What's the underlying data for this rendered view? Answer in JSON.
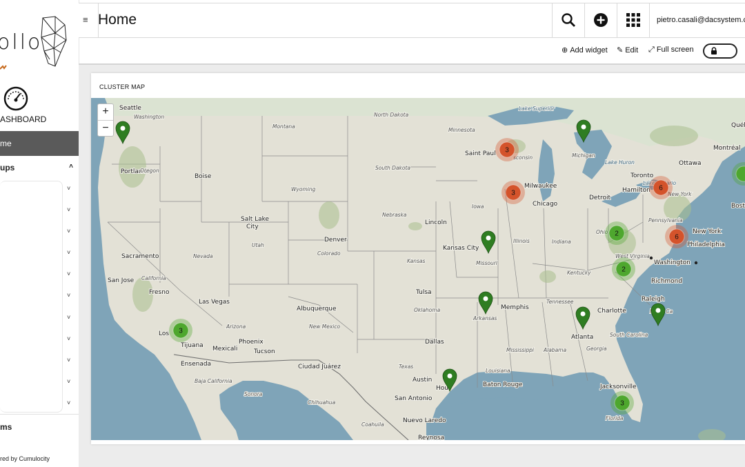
{
  "sidebar": {
    "brand_text": "ollo",
    "dashboard_label": "ASHBOARD",
    "home_item": "me",
    "groups_label": "ups",
    "alarms_label": "ms",
    "powered_by": "red by Cumulocity"
  },
  "header": {
    "title": "Home",
    "user_email": "pietro.casali@dacsystem.c"
  },
  "actions": {
    "add_widget": "Add widget",
    "edit": "Edit",
    "full_screen": "Full screen"
  },
  "widget": {
    "title": "CLUSTER MAP",
    "zoom_in": "+",
    "zoom_out": "−"
  },
  "colors": {
    "cluster_green": "#4ea72e",
    "cluster_red": "#d4532b",
    "pin_green": "#2f7d22",
    "water": "#7fa4b8",
    "land": "#e3e1d6"
  },
  "map": {
    "labels": [
      {
        "id": "seattle",
        "text": "Seattle",
        "kind": "city"
      },
      {
        "id": "washington-st",
        "text": "Washington",
        "kind": "state"
      },
      {
        "id": "portland",
        "text": "Portland",
        "kind": "city"
      },
      {
        "id": "oregon",
        "text": "Oregon",
        "kind": "state"
      },
      {
        "id": "montana",
        "text": "Montana",
        "kind": "state"
      },
      {
        "id": "north-dakota",
        "text": "North Dakota",
        "kind": "state"
      },
      {
        "id": "south-dakota",
        "text": "South Dakota",
        "kind": "state"
      },
      {
        "id": "minnesota",
        "text": "Minnesota",
        "kind": "state"
      },
      {
        "id": "lake-superior",
        "text": "Lake Superior",
        "kind": "water"
      },
      {
        "id": "boise",
        "text": "Boise",
        "kind": "city"
      },
      {
        "id": "wyoming",
        "text": "Wyoming",
        "kind": "state"
      },
      {
        "id": "saint-paul",
        "text": "Saint Paul",
        "kind": "city"
      },
      {
        "id": "wisconsin",
        "text": "sconsin",
        "kind": "state"
      },
      {
        "id": "michigan",
        "text": "Michigan",
        "kind": "state"
      },
      {
        "id": "lake-huron",
        "text": "Lake Huron",
        "kind": "water"
      },
      {
        "id": "ottawa",
        "text": "Ottawa",
        "kind": "city"
      },
      {
        "id": "montreal",
        "text": "Montréal",
        "kind": "city"
      },
      {
        "id": "quebec",
        "text": "Québe",
        "kind": "city"
      },
      {
        "id": "toronto",
        "text": "Toronto",
        "kind": "city"
      },
      {
        "id": "hamilton",
        "text": "Hamilton",
        "kind": "city"
      },
      {
        "id": "new-york-st",
        "text": "New York",
        "kind": "state"
      },
      {
        "id": "lake-ontario",
        "text": "Lake Ontario",
        "kind": "water"
      },
      {
        "id": "milwaukee",
        "text": "Milwaukee",
        "kind": "city"
      },
      {
        "id": "chicago",
        "text": "Chicago",
        "kind": "city"
      },
      {
        "id": "detroit",
        "text": "Detroit",
        "kind": "city"
      },
      {
        "id": "boston",
        "text": "Bost",
        "kind": "city"
      },
      {
        "id": "salt-lake-city",
        "text": "Salt Lake\nCity",
        "kind": "city"
      },
      {
        "id": "nebraska",
        "text": "Nebraska",
        "kind": "state"
      },
      {
        "id": "iowa",
        "text": "Iowa",
        "kind": "state"
      },
      {
        "id": "lincoln",
        "text": "Lincoln",
        "kind": "city"
      },
      {
        "id": "pennsylvania",
        "text": "Pennsylvania",
        "kind": "state"
      },
      {
        "id": "new-york-city",
        "text": "New York",
        "kind": "city"
      },
      {
        "id": "ohio",
        "text": "Ohio",
        "kind": "state"
      },
      {
        "id": "philadelphia",
        "text": "Philadelphia",
        "kind": "city"
      },
      {
        "id": "utah",
        "text": "Utah",
        "kind": "state"
      },
      {
        "id": "denver",
        "text": "Denver",
        "kind": "city"
      },
      {
        "id": "colorado",
        "text": "Colorado",
        "kind": "state"
      },
      {
        "id": "kansas-city",
        "text": "Kansas City",
        "kind": "city"
      },
      {
        "id": "illinois",
        "text": "Illinois",
        "kind": "state"
      },
      {
        "id": "indiana",
        "text": "Indiana",
        "kind": "state"
      },
      {
        "id": "missouri",
        "text": "Missouri",
        "kind": "state"
      },
      {
        "id": "west-virginia",
        "text": "West Virginia",
        "kind": "state"
      },
      {
        "id": "washington-dc",
        "text": "Washington",
        "kind": "city"
      },
      {
        "id": "sacramento",
        "text": "Sacramento",
        "kind": "city"
      },
      {
        "id": "nevada",
        "text": "Nevada",
        "kind": "state"
      },
      {
        "id": "kansas",
        "text": "Kansas",
        "kind": "state"
      },
      {
        "id": "kentucky",
        "text": "Kentucky",
        "kind": "state"
      },
      {
        "id": "richmond",
        "text": "Richmond",
        "kind": "city"
      },
      {
        "id": "san-jose",
        "text": "San Jose",
        "kind": "city"
      },
      {
        "id": "california",
        "text": "California",
        "kind": "state"
      },
      {
        "id": "fresno",
        "text": "Fresno",
        "kind": "city"
      },
      {
        "id": "tulsa",
        "text": "Tulsa",
        "kind": "city"
      },
      {
        "id": "oklahoma",
        "text": "Oklahoma",
        "kind": "state"
      },
      {
        "id": "memphis",
        "text": "Memphis",
        "kind": "city"
      },
      {
        "id": "tennessee",
        "text": "Tennessee",
        "kind": "state"
      },
      {
        "id": "raleigh",
        "text": "Raleigh",
        "kind": "city"
      },
      {
        "id": "las-vegas",
        "text": "Las Vegas",
        "kind": "city"
      },
      {
        "id": "albuquerque",
        "text": "Albuquerque",
        "kind": "city"
      },
      {
        "id": "arkansas",
        "text": "Arkansas",
        "kind": "state"
      },
      {
        "id": "charlotte",
        "text": "Charlotte",
        "kind": "city"
      },
      {
        "id": "north-carolina",
        "text": "North Ca",
        "kind": "state"
      },
      {
        "id": "new-mexico",
        "text": "New Mexico",
        "kind": "state"
      },
      {
        "id": "arizona",
        "text": "Arizona",
        "kind": "state"
      },
      {
        "id": "los-angeles",
        "text": "Los",
        "kind": "city"
      },
      {
        "id": "phoenix",
        "text": "Phoenix",
        "kind": "city"
      },
      {
        "id": "atlanta",
        "text": "Atlanta",
        "kind": "city"
      },
      {
        "id": "south-carolina",
        "text": "South Carolina",
        "kind": "state"
      },
      {
        "id": "dallas",
        "text": "Dallas",
        "kind": "city"
      },
      {
        "id": "tijuana",
        "text": "Tijuana",
        "kind": "city"
      },
      {
        "id": "mexicali",
        "text": "Mexicali",
        "kind": "city"
      },
      {
        "id": "tucson",
        "text": "Tucson",
        "kind": "city"
      },
      {
        "id": "mississippi",
        "text": "Mississippi",
        "kind": "state"
      },
      {
        "id": "alabama",
        "text": "Alabama",
        "kind": "state"
      },
      {
        "id": "georgia",
        "text": "Georgia",
        "kind": "state"
      },
      {
        "id": "ensenada",
        "text": "Ensenada",
        "kind": "city"
      },
      {
        "id": "ciudad-juarez",
        "text": "Ciudad Juárez",
        "kind": "city"
      },
      {
        "id": "texas",
        "text": "Texas",
        "kind": "state"
      },
      {
        "id": "louisiana",
        "text": "Louisiana",
        "kind": "state"
      },
      {
        "id": "baja-california",
        "text": "Baja California",
        "kind": "state"
      },
      {
        "id": "sonora",
        "text": "Sonora",
        "kind": "state"
      },
      {
        "id": "austin",
        "text": "Austin",
        "kind": "city"
      },
      {
        "id": "houston",
        "text": "Hou",
        "kind": "city"
      },
      {
        "id": "baton-rouge",
        "text": "Baton Rouge",
        "kind": "city"
      },
      {
        "id": "jacksonville",
        "text": "Jacksonville",
        "kind": "city"
      },
      {
        "id": "san-antonio",
        "text": "San Antonio",
        "kind": "city"
      },
      {
        "id": "chihuahua",
        "text": "Chihuahua",
        "kind": "state"
      },
      {
        "id": "coahuila",
        "text": "Coahuila",
        "kind": "state"
      },
      {
        "id": "nuevo-laredo",
        "text": "Nuevo Laredo",
        "kind": "city"
      },
      {
        "id": "florida",
        "text": "Florida",
        "kind": "state"
      },
      {
        "id": "reynosa",
        "text": "Reynosa",
        "kind": "city"
      }
    ],
    "clusters": [
      {
        "id": "saint-paul",
        "count": "3",
        "status": "red"
      },
      {
        "id": "milwaukee",
        "count": "3",
        "status": "red"
      },
      {
        "id": "toronto",
        "count": "6",
        "status": "red"
      },
      {
        "id": "philadelphia",
        "count": "6",
        "status": "red"
      },
      {
        "id": "ohio",
        "count": "2",
        "status": "green"
      },
      {
        "id": "west-virginia",
        "count": "2",
        "status": "green"
      },
      {
        "id": "los-angeles",
        "count": "3",
        "status": "green"
      },
      {
        "id": "florida",
        "count": "3",
        "status": "green"
      },
      {
        "id": "vermont",
        "count": "",
        "status": "green"
      }
    ],
    "pins": [
      {
        "id": "portland"
      },
      {
        "id": "michigan"
      },
      {
        "id": "kansas-city"
      },
      {
        "id": "arkansas"
      },
      {
        "id": "atlanta"
      },
      {
        "id": "north-carolina"
      },
      {
        "id": "houston"
      }
    ]
  }
}
